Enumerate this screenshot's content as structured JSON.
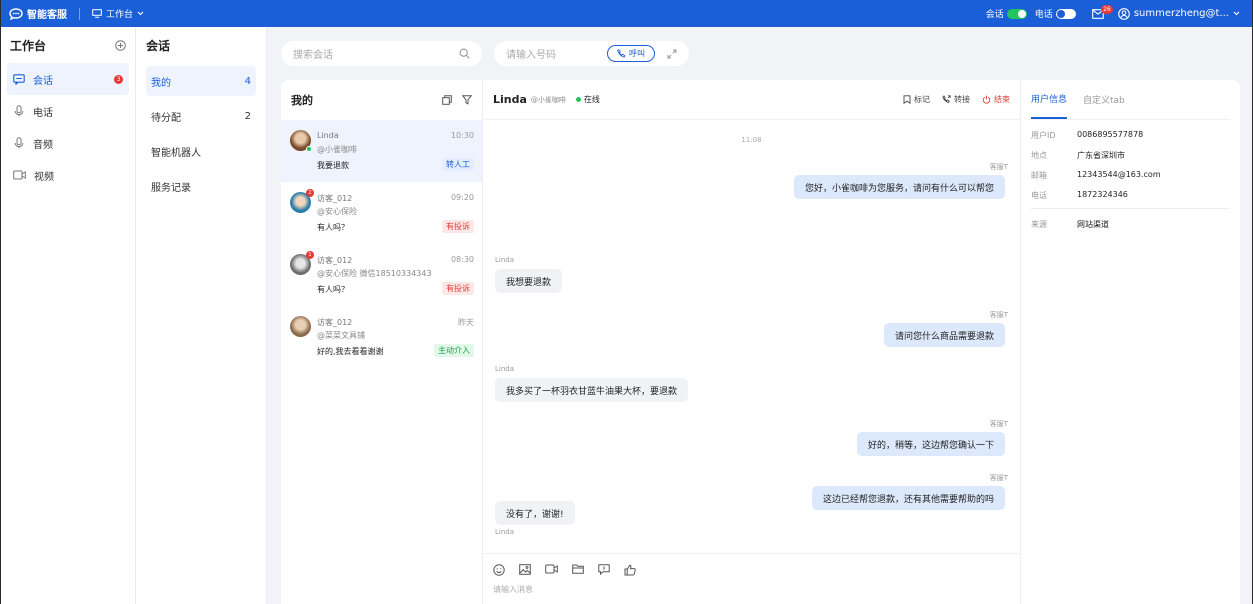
{
  "topbar": {
    "brand": "智能客服",
    "workspace": "工作台",
    "toggle_chat_label": "会话",
    "toggle_phone_label": "电话",
    "mail_badge": "26",
    "username": "summerzheng@t...",
    "colors": {
      "bar": "#1a5fd8",
      "on": "#22c55e"
    }
  },
  "sidebar": {
    "title": "工作台",
    "items": [
      {
        "label": "会话",
        "icon": "chat-icon",
        "badge": "3",
        "active": true
      },
      {
        "label": "电话",
        "icon": "microphone-icon"
      },
      {
        "label": "音频",
        "icon": "microphone-icon"
      },
      {
        "label": "视频",
        "icon": "video-icon"
      }
    ]
  },
  "subnav": {
    "title": "会话",
    "items": [
      {
        "label": "我的",
        "count": "4",
        "active": true
      },
      {
        "label": "待分配",
        "count": "2"
      },
      {
        "label": "智能机器人",
        "count": ""
      },
      {
        "label": "服务记录",
        "count": ""
      }
    ]
  },
  "search": {
    "placeholder": "搜索会话"
  },
  "dial": {
    "placeholder": "请输入号码",
    "call_label": "呼叫"
  },
  "conversations": {
    "title": "我的",
    "items": [
      {
        "name": "Linda",
        "source": "@小雀咖啡",
        "time": "10:30",
        "message": "我要退款",
        "tag": "转人工",
        "tag_color": "blue"
      },
      {
        "name": "访客_012",
        "source": "@安心保险",
        "time": "09:20",
        "message": "有人吗？",
        "tag": "有投诉",
        "tag_color": "red"
      },
      {
        "name": "访客_012",
        "source": "@安心保险 微信18510334343",
        "time": "08:30",
        "message": "有人吗？",
        "tag": "有投诉",
        "tag_color": "red"
      },
      {
        "name": "访客_012",
        "source": "@菜菜文具铺",
        "time": "昨天",
        "message": "好的,我去看看谢谢",
        "tag": "主动介入",
        "tag_color": "green"
      }
    ]
  },
  "chat": {
    "name": "Linda",
    "source": "@小雀咖啡",
    "status": "在线",
    "actions": {
      "mark": "标记",
      "transfer": "转接",
      "end": "结束"
    },
    "timestamp": "11:08",
    "messages": [
      {
        "from": "agent",
        "sender": "客服T",
        "text": "您好，小雀咖啡为您服务，请问有什么可以帮您"
      },
      {
        "from": "user",
        "sender": "Linda",
        "text": "我想要退款"
      },
      {
        "from": "agent",
        "sender": "客服T",
        "text": "请问您什么商品需要退款"
      },
      {
        "from": "user",
        "sender": "Linda",
        "text": "我多买了一杯羽衣甘蓝牛油果大杯，要退款"
      },
      {
        "from": "agent",
        "sender": "客服T",
        "text": "好的，稍等，这边帮您确认一下"
      },
      {
        "from": "agent",
        "sender": "客服T",
        "text": "这边已经帮您退款，还有其他需要帮助的吗"
      },
      {
        "from": "user",
        "sender": "Linda",
        "text": "没有了，谢谢!"
      }
    ],
    "input_placeholder": "请输入消息"
  },
  "user_info": {
    "tabs": [
      "用户信息",
      "自定义tab"
    ],
    "fields": [
      {
        "key": "用户ID",
        "value": "0086895577878"
      },
      {
        "key": "地点",
        "value": "广东省深圳市"
      },
      {
        "key": "邮箱",
        "value": "12343544@163.com"
      },
      {
        "key": "电话",
        "value": "1872324346"
      }
    ],
    "extra": {
      "key": "来源",
      "value": "网站渠道"
    }
  }
}
